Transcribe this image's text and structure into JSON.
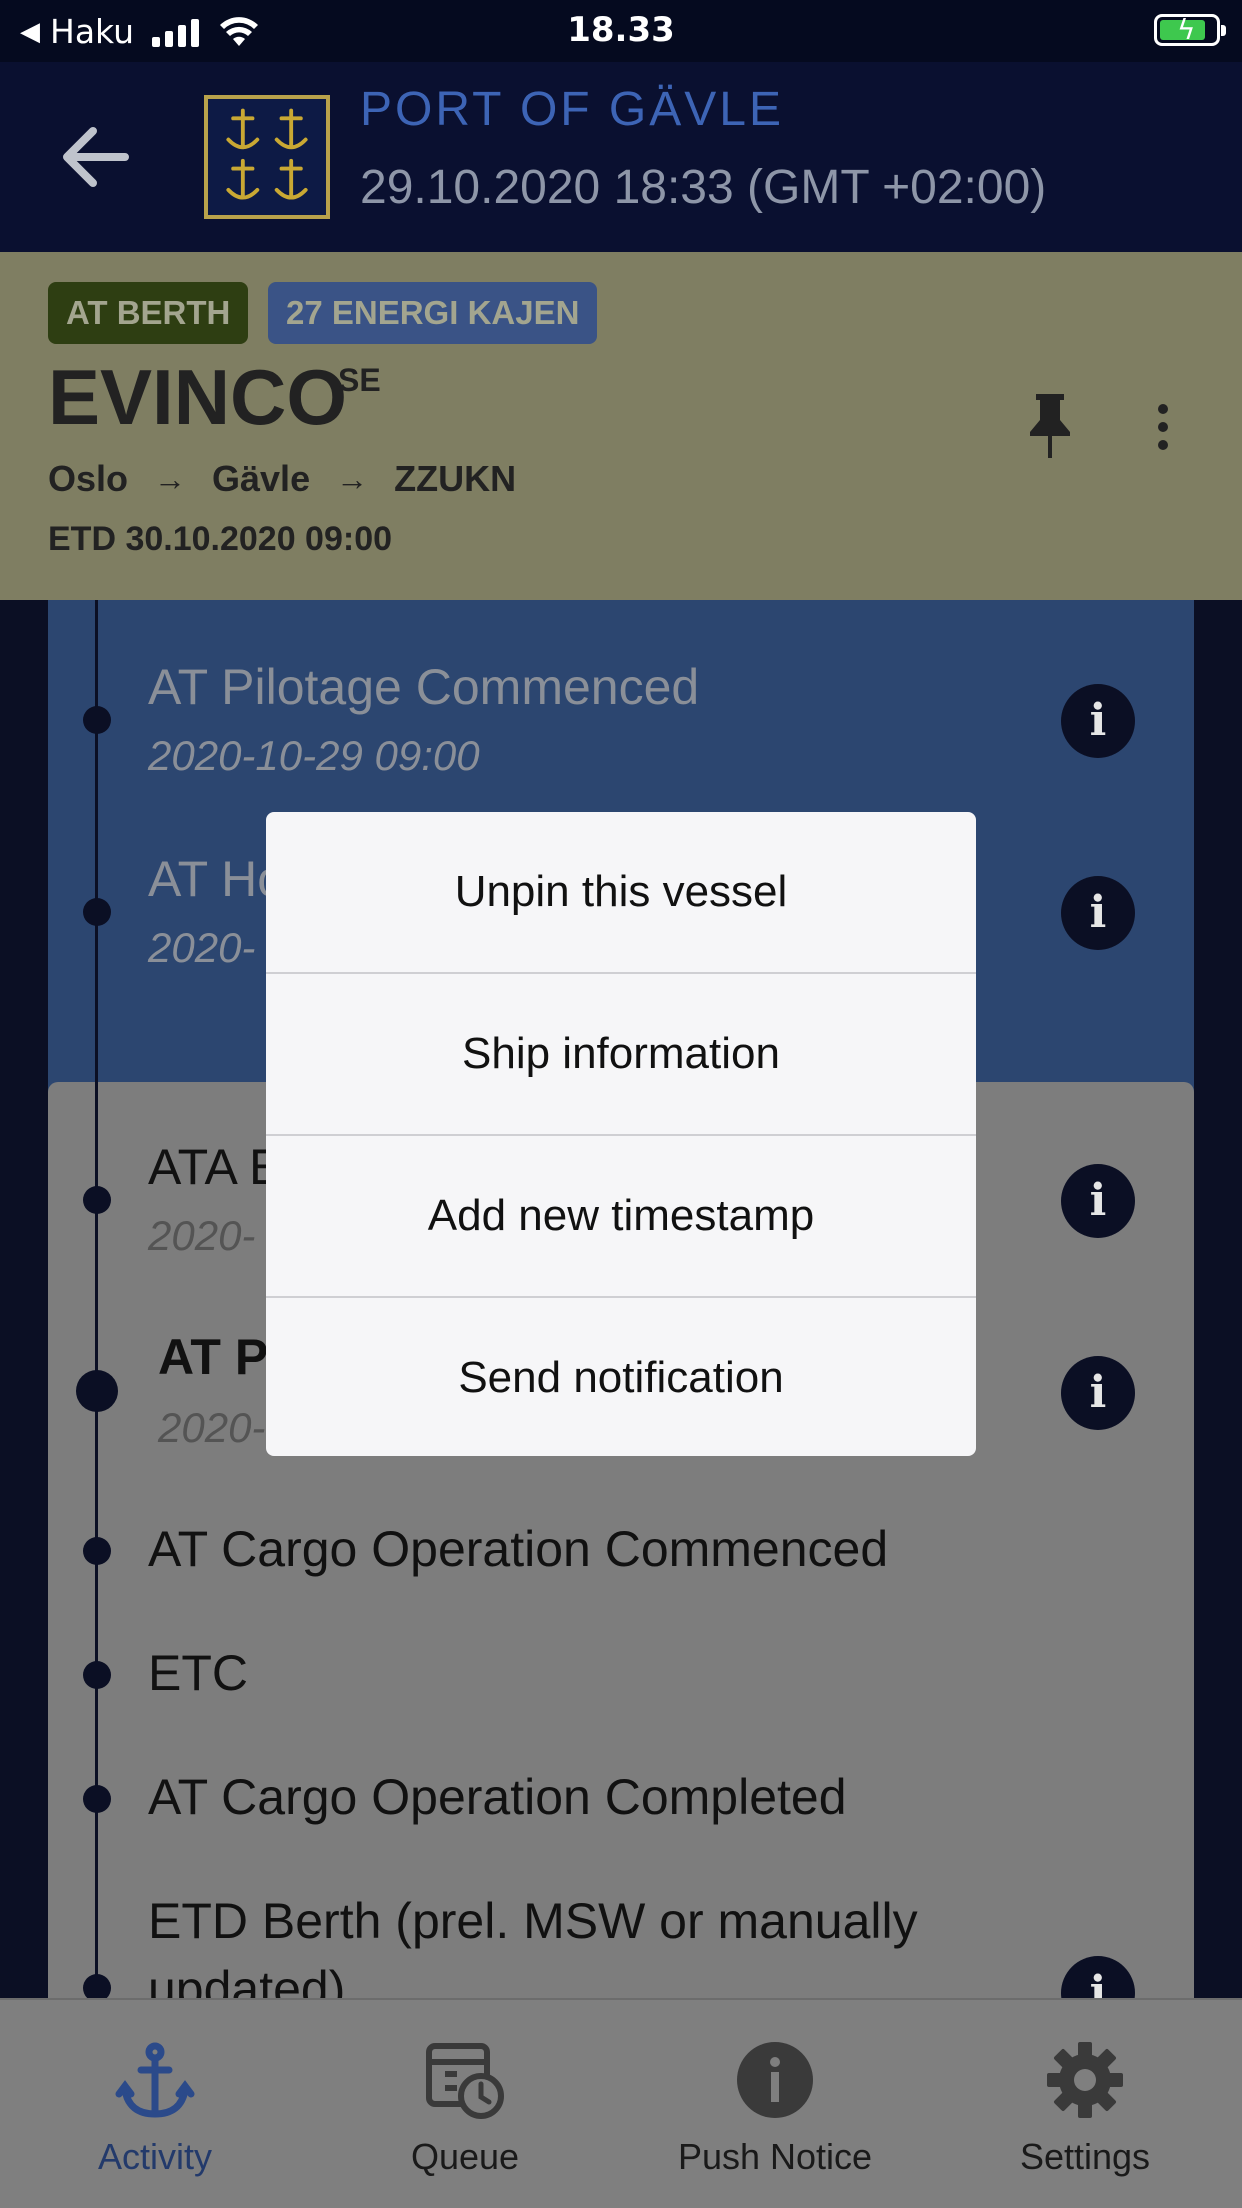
{
  "status_bar": {
    "carrier": "Haku",
    "time": "18.33"
  },
  "header": {
    "port_name": "PORT OF GÄVLE",
    "datetime": "29.10.2020 18:33 (GMT +02:00)"
  },
  "vessel": {
    "state_tag": "AT BERTH",
    "berth_tag": "27 ENERGI KAJEN",
    "name": "EVINCO",
    "flag": "SE",
    "route": [
      "Oslo",
      "Gävle",
      "ZZUKN"
    ],
    "route_arrow": "→",
    "etd": "ETD 30.10.2020 09:00"
  },
  "timeline": {
    "blue_group": [
      {
        "title": "AT Pilotage Commenced",
        "date": "2020-10-29 09:00"
      },
      {
        "title": "AT Ho",
        "date": "2020-"
      }
    ],
    "grey_group": [
      {
        "title": "ATA E",
        "date": "2020-"
      },
      {
        "title": "AT P",
        "date": "2020-"
      },
      {
        "title": "AT Cargo Operation Commenced"
      },
      {
        "title": "ETC"
      },
      {
        "title": "AT Cargo Operation Completed"
      },
      {
        "title": "ETD Berth (prel. MSW or manually",
        "title2": "updated)"
      }
    ],
    "info_glyph": "i"
  },
  "menu": {
    "items": [
      "Unpin this vessel",
      "Ship information",
      "Add new timestamp",
      "Send notification"
    ]
  },
  "tabbar": {
    "tabs": [
      {
        "label": "Activity",
        "icon": "anchor-icon"
      },
      {
        "label": "Queue",
        "icon": "calendar-clock-icon"
      },
      {
        "label": "Push Notice",
        "icon": "info-icon"
      },
      {
        "label": "Settings",
        "icon": "gear-icon"
      }
    ]
  },
  "colors": {
    "nav_bg": "#0a1030",
    "accent_blue": "#3d64b5",
    "vessel_card": "#7f7e62",
    "tag_green": "#2e3e12",
    "tag_blue": "#3a5386"
  }
}
